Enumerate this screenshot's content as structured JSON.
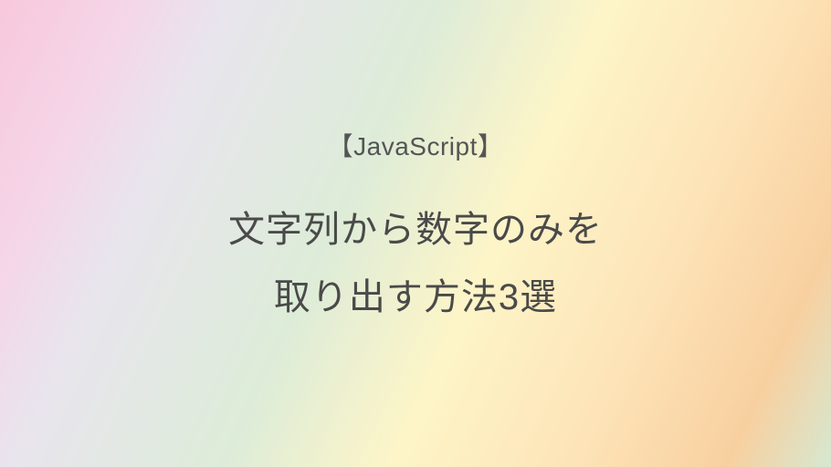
{
  "card": {
    "tag": "【JavaScript】",
    "title_line1": "文字列から数字のみを",
    "title_line2": "取り出す方法3選"
  }
}
